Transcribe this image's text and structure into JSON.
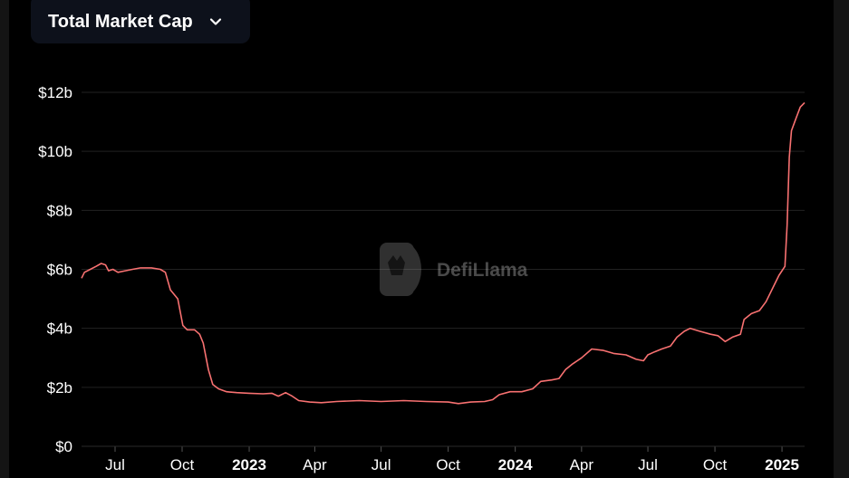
{
  "selector": {
    "label": "Total Market Cap"
  },
  "watermark": {
    "text": "DefiLlama"
  },
  "colors": {
    "line": "#f87171",
    "grid": "#222222",
    "background": "#000000",
    "selector_bg": "#0d111b"
  },
  "chart_data": {
    "type": "line",
    "title": "",
    "xlabel": "",
    "ylabel": "",
    "x_range": [
      "2022-05-16",
      "2025-02-01"
    ],
    "ylim": [
      0,
      12
    ],
    "y_ticks": [
      {
        "value": 0,
        "label": "$0"
      },
      {
        "value": 2,
        "label": "$2b"
      },
      {
        "value": 4,
        "label": "$4b"
      },
      {
        "value": 6,
        "label": "$6b"
      },
      {
        "value": 8,
        "label": "$8b"
      },
      {
        "value": 10,
        "label": "$10b"
      },
      {
        "value": 12,
        "label": "$12b"
      }
    ],
    "x_ticks": [
      {
        "date": "2022-07-01",
        "label": "Jul",
        "bold": false
      },
      {
        "date": "2022-10-01",
        "label": "Oct",
        "bold": false
      },
      {
        "date": "2023-01-01",
        "label": "2023",
        "bold": true
      },
      {
        "date": "2023-04-01",
        "label": "Apr",
        "bold": false
      },
      {
        "date": "2023-07-01",
        "label": "Jul",
        "bold": false
      },
      {
        "date": "2023-10-01",
        "label": "Oct",
        "bold": false
      },
      {
        "date": "2024-01-01",
        "label": "2024",
        "bold": true
      },
      {
        "date": "2024-04-01",
        "label": "Apr",
        "bold": false
      },
      {
        "date": "2024-07-01",
        "label": "Jul",
        "bold": false
      },
      {
        "date": "2024-10-01",
        "label": "Oct",
        "bold": false
      },
      {
        "date": "2025-01-01",
        "label": "2025",
        "bold": true
      }
    ],
    "grid": true,
    "series": [
      {
        "name": "Total Market Cap",
        "points": [
          [
            "2022-05-16",
            5.7
          ],
          [
            "2022-05-20",
            5.9
          ],
          [
            "2022-05-28",
            6.0
          ],
          [
            "2022-06-05",
            6.1
          ],
          [
            "2022-06-12",
            6.2
          ],
          [
            "2022-06-18",
            6.15
          ],
          [
            "2022-06-22",
            5.95
          ],
          [
            "2022-06-28",
            6.0
          ],
          [
            "2022-07-05",
            5.9
          ],
          [
            "2022-07-15",
            5.95
          ],
          [
            "2022-07-25",
            6.0
          ],
          [
            "2022-08-05",
            6.05
          ],
          [
            "2022-08-20",
            6.05
          ],
          [
            "2022-09-01",
            6.0
          ],
          [
            "2022-09-08",
            5.9
          ],
          [
            "2022-09-15",
            5.3
          ],
          [
            "2022-09-25",
            5.0
          ],
          [
            "2022-10-02",
            4.1
          ],
          [
            "2022-10-08",
            3.95
          ],
          [
            "2022-10-18",
            3.95
          ],
          [
            "2022-10-25",
            3.8
          ],
          [
            "2022-10-30",
            3.5
          ],
          [
            "2022-11-06",
            2.6
          ],
          [
            "2022-11-12",
            2.1
          ],
          [
            "2022-11-20",
            1.95
          ],
          [
            "2022-12-01",
            1.85
          ],
          [
            "2022-12-15",
            1.82
          ],
          [
            "2023-01-01",
            1.8
          ],
          [
            "2023-01-20",
            1.78
          ],
          [
            "2023-02-01",
            1.8
          ],
          [
            "2023-02-10",
            1.7
          ],
          [
            "2023-02-20",
            1.82
          ],
          [
            "2023-03-01",
            1.7
          ],
          [
            "2023-03-10",
            1.55
          ],
          [
            "2023-03-25",
            1.5
          ],
          [
            "2023-04-10",
            1.48
          ],
          [
            "2023-05-01",
            1.52
          ],
          [
            "2023-06-01",
            1.55
          ],
          [
            "2023-07-01",
            1.52
          ],
          [
            "2023-08-01",
            1.55
          ],
          [
            "2023-09-01",
            1.52
          ],
          [
            "2023-10-01",
            1.5
          ],
          [
            "2023-10-15",
            1.45
          ],
          [
            "2023-11-01",
            1.5
          ],
          [
            "2023-11-20",
            1.52
          ],
          [
            "2023-12-01",
            1.58
          ],
          [
            "2023-12-10",
            1.75
          ],
          [
            "2023-12-25",
            1.85
          ],
          [
            "2024-01-10",
            1.85
          ],
          [
            "2024-01-25",
            1.95
          ],
          [
            "2024-02-05",
            2.2
          ],
          [
            "2024-02-20",
            2.25
          ],
          [
            "2024-03-01",
            2.3
          ],
          [
            "2024-03-10",
            2.6
          ],
          [
            "2024-03-20",
            2.8
          ],
          [
            "2024-04-01",
            3.0
          ],
          [
            "2024-04-15",
            3.3
          ],
          [
            "2024-05-01",
            3.25
          ],
          [
            "2024-05-15",
            3.15
          ],
          [
            "2024-06-01",
            3.1
          ],
          [
            "2024-06-15",
            2.95
          ],
          [
            "2024-06-25",
            2.9
          ],
          [
            "2024-07-01",
            3.1
          ],
          [
            "2024-07-10",
            3.2
          ],
          [
            "2024-07-20",
            3.3
          ],
          [
            "2024-08-01",
            3.4
          ],
          [
            "2024-08-10",
            3.7
          ],
          [
            "2024-08-20",
            3.9
          ],
          [
            "2024-08-28",
            4.0
          ],
          [
            "2024-09-10",
            3.9
          ],
          [
            "2024-09-25",
            3.8
          ],
          [
            "2024-10-05",
            3.75
          ],
          [
            "2024-10-15",
            3.55
          ],
          [
            "2024-10-25",
            3.7
          ],
          [
            "2024-11-05",
            3.8
          ],
          [
            "2024-11-10",
            4.3
          ],
          [
            "2024-11-20",
            4.5
          ],
          [
            "2024-12-01",
            4.6
          ],
          [
            "2024-12-10",
            4.9
          ],
          [
            "2024-12-20",
            5.4
          ],
          [
            "2024-12-28",
            5.8
          ],
          [
            "2025-01-05",
            6.1
          ],
          [
            "2025-01-08",
            7.5
          ],
          [
            "2025-01-11",
            9.8
          ],
          [
            "2025-01-14",
            10.7
          ],
          [
            "2025-01-20",
            11.1
          ],
          [
            "2025-01-26",
            11.5
          ],
          [
            "2025-02-01",
            11.65
          ]
        ]
      }
    ]
  }
}
